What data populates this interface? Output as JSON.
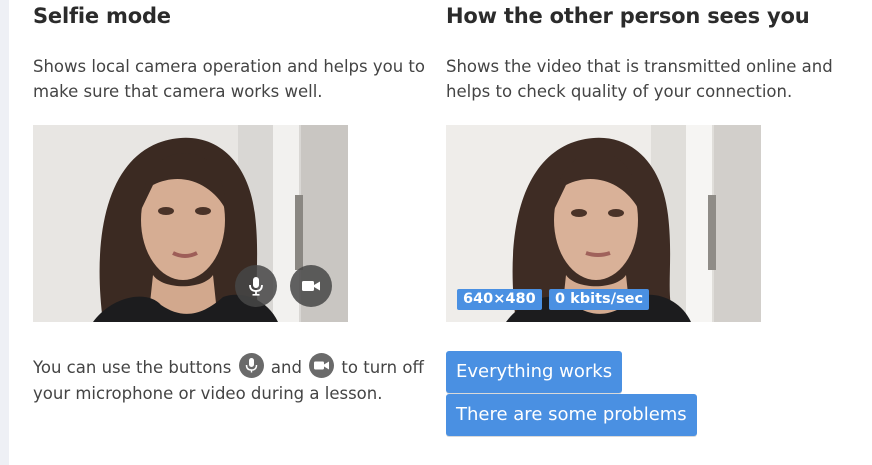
{
  "selfie": {
    "title": "Selfie mode",
    "description_line1": "Shows local camera operation and helps you to",
    "description_line2": "make sure that camera works well.",
    "note_part1": "You can use the buttons",
    "note_part2": "and",
    "note_part3": "to turn off",
    "note_line2": "your microphone or video during a lesson."
  },
  "remote": {
    "title": "How the other person sees you",
    "description_line1": "Shows the video that is transmitted online and",
    "description_line2": "helps to check quality of your connection.",
    "resolution_badge": "640×480",
    "bitrate_badge": "0 kbits/sec",
    "works_button": "Everything works",
    "problems_button": "There are some problems"
  },
  "icons": {
    "microphone": "microphone-icon",
    "camera": "video-camera-icon"
  },
  "colors": {
    "accent": "#4a90e2",
    "control_bg": "#464646",
    "text": "#444444"
  }
}
